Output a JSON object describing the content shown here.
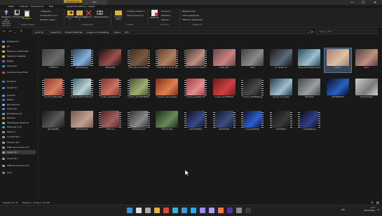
{
  "window": {
    "tab_manage": "Управление",
    "tab_folder": "SFX",
    "menus": [
      "Файл",
      "Главная",
      "Поделиться",
      "Вид",
      "Средства работы с видео"
    ],
    "controls": {
      "minimize": "—",
      "maximize": "☐",
      "close": "✕"
    }
  },
  "ribbon": {
    "clipboard": {
      "pin": "Закрепить на панели быстрого доступа",
      "copy": "Копировать",
      "paste": "Вставить",
      "cut": "Вырезать",
      "copy_path": "Скопировать путь",
      "paste_shortcut": "Вставить ярлык",
      "group": "Буфер обмена"
    },
    "organize": {
      "move": "Переместить в",
      "copy_to": "Копировать в",
      "delete": "Удалить",
      "rename": "Переименовать",
      "group": "Упорядочить"
    },
    "new": {
      "new_folder": "Создать папку",
      "new_item": "Создать элемент",
      "easy_access": "Простой доступ",
      "group": "Создать"
    },
    "open": {
      "properties": "Свойства",
      "open": "Открыть",
      "edit": "Изменить",
      "history": "Журнал",
      "group": "Открыть"
    },
    "select": {
      "select_all": "Выделить все",
      "select_none": "Снять выделение",
      "invert": "Обратить выделение",
      "group": "Выделить"
    }
  },
  "address": {
    "crumbs": [
      "Lpull PC",
      "Speed (E:)",
      "Project Materials",
      "скидки на marketing",
      "video1",
      "SFX"
    ],
    "search_placeholder": "Поиск: SFX"
  },
  "navpane": [
    {
      "label": "Избранное",
      "color": "#4a90d9"
    },
    {
      "label": "git",
      "color": "#e0b84a"
    },
    {
      "label": "Видео и multimedia",
      "color": "#e0b84a"
    },
    {
      "label": "Telegram Desktop",
      "color": "#e0b84a"
    },
    {
      "label": "Видео",
      "color": "#7b5fc7"
    },
    {
      "label": "Загрузки",
      "color": "#3b8ed9"
    },
    {
      "label": "Creative Cloud Files",
      "color": "#d94a4a"
    },
    {
      "label": "Dropbox",
      "color": "#3b6fd9"
    },
    {
      "label": "OneDrive",
      "color": "#3b8ed9"
    },
    {
      "label": "Lpull PC",
      "color": "#4aa3d9"
    },
    {
      "label": "Видео",
      "color": "#7b5fc7"
    },
    {
      "label": "Документы",
      "color": "#9ab0c4"
    },
    {
      "label": "Загрузки",
      "color": "#3b8ed9"
    },
    {
      "label": "Изображения",
      "color": "#4ab0d9"
    },
    {
      "label": "Музыка",
      "color": "#d97b3b"
    },
    {
      "label": "Объемные объекты",
      "color": "#4ad9c4"
    },
    {
      "label": "Рабочий стол",
      "color": "#4a90d9"
    },
    {
      "label": "SSD (C:)",
      "color": "#9a9a9a"
    },
    {
      "label": "Content (D:)",
      "color": "#9a9a9a"
    },
    {
      "label": "Chrome (E:)",
      "color": "#9a9a9a"
    },
    {
      "label": "USB-накопитель (F:)",
      "color": "#9a9a9a"
    },
    {
      "label": "Speed (E:)",
      "color": "#9a9a9a"
    },
    {
      "label": "Amen (G:)",
      "color": "#9a9a9a"
    },
    {
      "label": "USB-накопитель (F:)",
      "color": "#9a9a9a"
    },
    {
      "label": "Сеть",
      "color": "#4a90d9"
    }
  ],
  "files": [
    {
      "name": "758FBF-ff",
      "c1": "#3e3e3e",
      "c2": "#6a6a6a",
      "video": false
    },
    {
      "name": "29b6a0ayyjd",
      "c1": "#1d3a5a",
      "c2": "#8ab0d9",
      "video": true
    },
    {
      "name": "680e6c0fa",
      "c1": "#161010",
      "c2": "#a05050",
      "video": false
    },
    {
      "name": "2021-06-11 16-55-44",
      "c1": "#3a2a20",
      "c2": "#7a5a40",
      "video": true
    },
    {
      "name": "2021-06-11 16-55-46",
      "c1": "#5a3a28",
      "c2": "#b08060",
      "video": true
    },
    {
      "name": "2021-06-13 17-09-41",
      "c1": "#3a3030",
      "c2": "#c09080",
      "video": true
    },
    {
      "name": "bottle_SFX",
      "c1": "#5a4a4a",
      "c2": "#d08080",
      "video": false
    },
    {
      "name": "clean",
      "c1": "#404040",
      "c2": "#8a8a8a",
      "video": false
    },
    {
      "name": "Fly Speed 37",
      "c1": "#1a1a1a",
      "c2": "#5a6a7a",
      "video": false
    },
    {
      "name": "Glass_SFX2/Glass_SFX2",
      "c1": "#2a4a5a",
      "c2": "#9ac0d0",
      "video": false
    },
    {
      "name": "hand 2",
      "c1": "#a08070",
      "c2": "#e0c0a0",
      "video": false
    },
    {
      "name": "hand",
      "c1": "#504040",
      "c2": "#c09080",
      "video": false
    },
    {
      "name": "houdini_tipft.mp4le",
      "c1": "#8a2a2a",
      "c2": "#d08060",
      "video": true
    },
    {
      "name": "houdini_SFXcolorDirect",
      "c1": "#2a5a6a",
      "c2": "#c0d0d0",
      "video": true
    },
    {
      "name": "houdini_paintyRoma",
      "c1": "#6a3030",
      "c2": "#d07060",
      "video": true
    },
    {
      "name": "houdini_paintflorNRAM",
      "c1": "#3a4a2a",
      "c2": "#a0b070",
      "video": true
    },
    {
      "name": "houdini_paint bypass",
      "c1": "#7a2a1a",
      "c2": "#e08050",
      "video": false
    },
    {
      "name": "houdini_pbALRpmof",
      "c1": "#a03040",
      "c2": "#e09090",
      "video": true
    },
    {
      "name": "houdini_pbnPHR/PH",
      "c1": "#6a1a20",
      "c2": "#d04040",
      "video": false
    },
    {
      "name": "houdini_SQIHRAPeng",
      "c1": "#101010",
      "c2": "#4a4a4a",
      "video": true
    },
    {
      "name": "houdini_trn-grnhe",
      "c1": "#2a3a4a",
      "c2": "#a0c0d0",
      "video": false
    },
    {
      "name": "LBshiteml",
      "c1": "#404548",
      "c2": "#9aa0a4",
      "video": false
    },
    {
      "name": "ZCSRK0NVtd",
      "c1": "#0a1020",
      "c2": "#2a60c0",
      "video": false
    },
    {
      "name": "liquid 2tweak",
      "c1": "#d0d0d0",
      "c2": "#7a7a7a",
      "video": false
    },
    {
      "name": "PC0afkefBle",
      "c1": "#1a1a1a",
      "c2": "#5a5a5a",
      "video": false
    },
    {
      "name": "pFHobrfmeld",
      "c1": "#7a5a50",
      "c2": "#c0a090",
      "video": false
    },
    {
      "name": "rdfsorcaa",
      "c1": "#4a2020",
      "c2": "#a06060",
      "video": true
    },
    {
      "name": "rSBODQkQodz",
      "c1": "#2a2a2a",
      "c2": "#8a8a8a",
      "video": true
    },
    {
      "name": "SFDsQryPop",
      "c1": "#1a2a1a",
      "c2": "#6a8a5a",
      "video": false
    },
    {
      "name": "sdvOPH8kPRs",
      "c1": "#0a0a10",
      "c2": "#3a4a8a",
      "video": true
    },
    {
      "name": "sAbrFdOAM",
      "c1": "#101020",
      "c2": "#3a5080",
      "video": true
    },
    {
      "name": "sLiowtrfdDMR",
      "c1": "#0a0a1a",
      "c2": "#2a60d0",
      "video": true
    },
    {
      "name": "sDvSPtBfrg",
      "c1": "#101010",
      "c2": "#3a3a3a",
      "video": true
    },
    {
      "name": "suLOPspBoop",
      "c1": "#0a0a0a",
      "c2": "#30408a",
      "video": true
    }
  ],
  "statusbar": {
    "count": "Элементов: 34",
    "selected": "Выбран 1 элемент: 167 КБ"
  },
  "taskbar": {
    "icons": [
      {
        "name": "windows-start",
        "color": "#3b8ed9"
      },
      {
        "name": "search",
        "color": "#dddddd"
      },
      {
        "name": "task-view",
        "color": "#aaaaaa"
      },
      {
        "name": "file-explorer",
        "color": "#e0b84a"
      },
      {
        "name": "chrome",
        "color": "#e04a3b"
      },
      {
        "name": "edge",
        "color": "#3bb0d9"
      },
      {
        "name": "telegram",
        "color": "#3b9ed9"
      },
      {
        "name": "photoshop",
        "color": "#31a8ff"
      },
      {
        "name": "after-effects",
        "color": "#9a8aff"
      },
      {
        "name": "premiere",
        "color": "#b09aff"
      },
      {
        "name": "houdini",
        "color": "#ff7a3b"
      },
      {
        "name": "media-encoder",
        "color": "#4a3aa0"
      },
      {
        "name": "app-generic",
        "color": "#8a8a8a"
      },
      {
        "name": "app-dark",
        "color": "#3a3a3a"
      }
    ],
    "time": "1:37",
    "date": "06.06.2021",
    "lang": "РУС"
  },
  "colors": {
    "accent_manage_tab": "#b8962f",
    "selection": "#3b4656"
  }
}
